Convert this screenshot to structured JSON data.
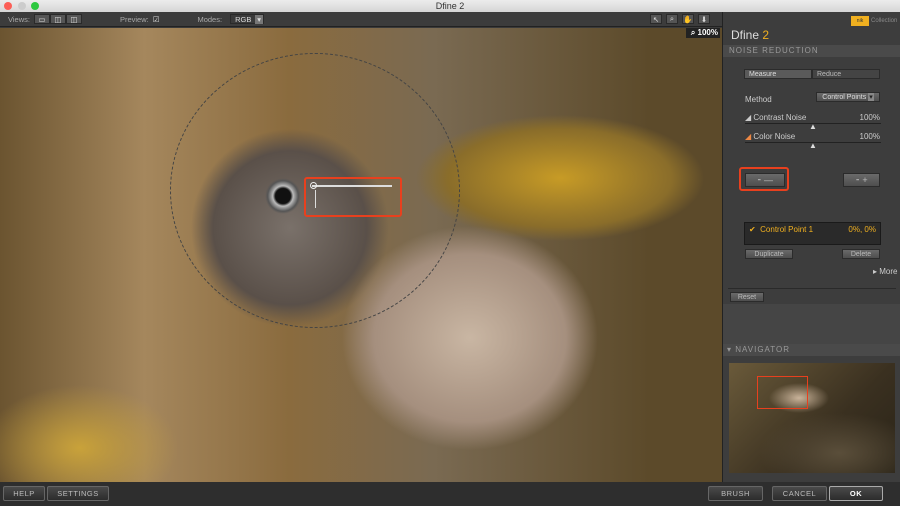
{
  "window": {
    "title": "Dfine 2"
  },
  "toolbar": {
    "views_label": "Views:",
    "preview_label": "Preview:",
    "modes_label": "Modes:",
    "mode_value": "RGB",
    "zoom": "100%"
  },
  "panel": {
    "logo": "nik Collection",
    "app_name": "Dfine",
    "app_version": "2",
    "section": "NOISE REDUCTION",
    "tabs": [
      "Measure",
      "Reduce"
    ],
    "method_label": "Method",
    "method_value": "Control Points",
    "contrast_noise_label": "Contrast Noise",
    "contrast_noise_value": "100%",
    "color_noise_label": "Color Noise",
    "color_noise_value": "100%",
    "control_point": {
      "name": "Control Point 1",
      "value": "0%, 0%"
    },
    "duplicate": "Duplicate",
    "delete": "Delete",
    "more": "More",
    "reset": "Reset",
    "navigator": "NAVIGATOR"
  },
  "bottom": {
    "help": "HELP",
    "settings": "SETTINGS",
    "brush": "BRUSH",
    "cancel": "CANCEL",
    "ok": "OK"
  },
  "colors": {
    "accent": "#f0b020",
    "highlight": "#e8401e"
  }
}
